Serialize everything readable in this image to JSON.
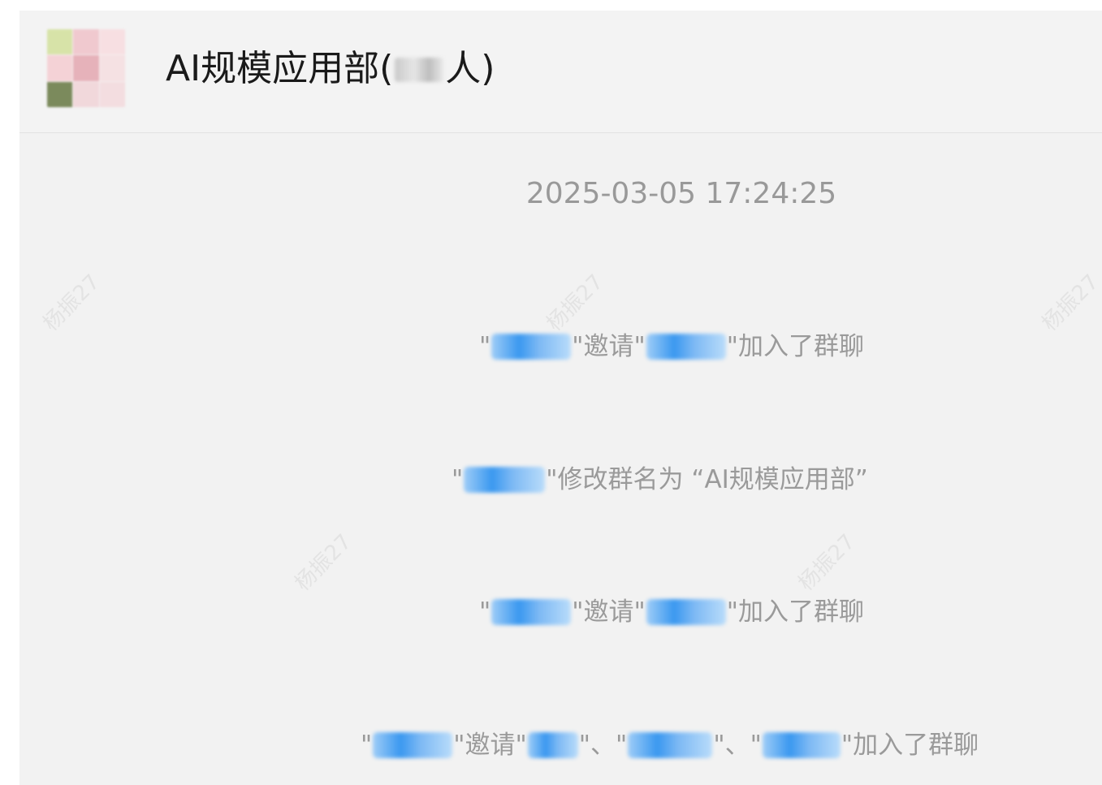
{
  "header": {
    "title_prefix": "AI规模应用部(",
    "title_suffix": "人)"
  },
  "chat": {
    "timestamp": "2025-03-05 17:24:25",
    "messages": [
      {
        "q1": "\"",
        "mid": "\"邀请\"",
        "tail": "\"加入了群聊"
      },
      {
        "q1": "\"",
        "tail": "\"修改群名为 “AI规模应用部”"
      },
      {
        "q1": "\"",
        "mid": "\"邀请\"",
        "tail": "\"加入了群聊"
      },
      {
        "q1": "\"",
        "mid": "\"邀请\"",
        "sep1": "\"、\"",
        "sep2": "\"、\"",
        "tail": "\"加入了群聊"
      }
    ]
  },
  "watermark": {
    "text": "杨振27"
  }
}
